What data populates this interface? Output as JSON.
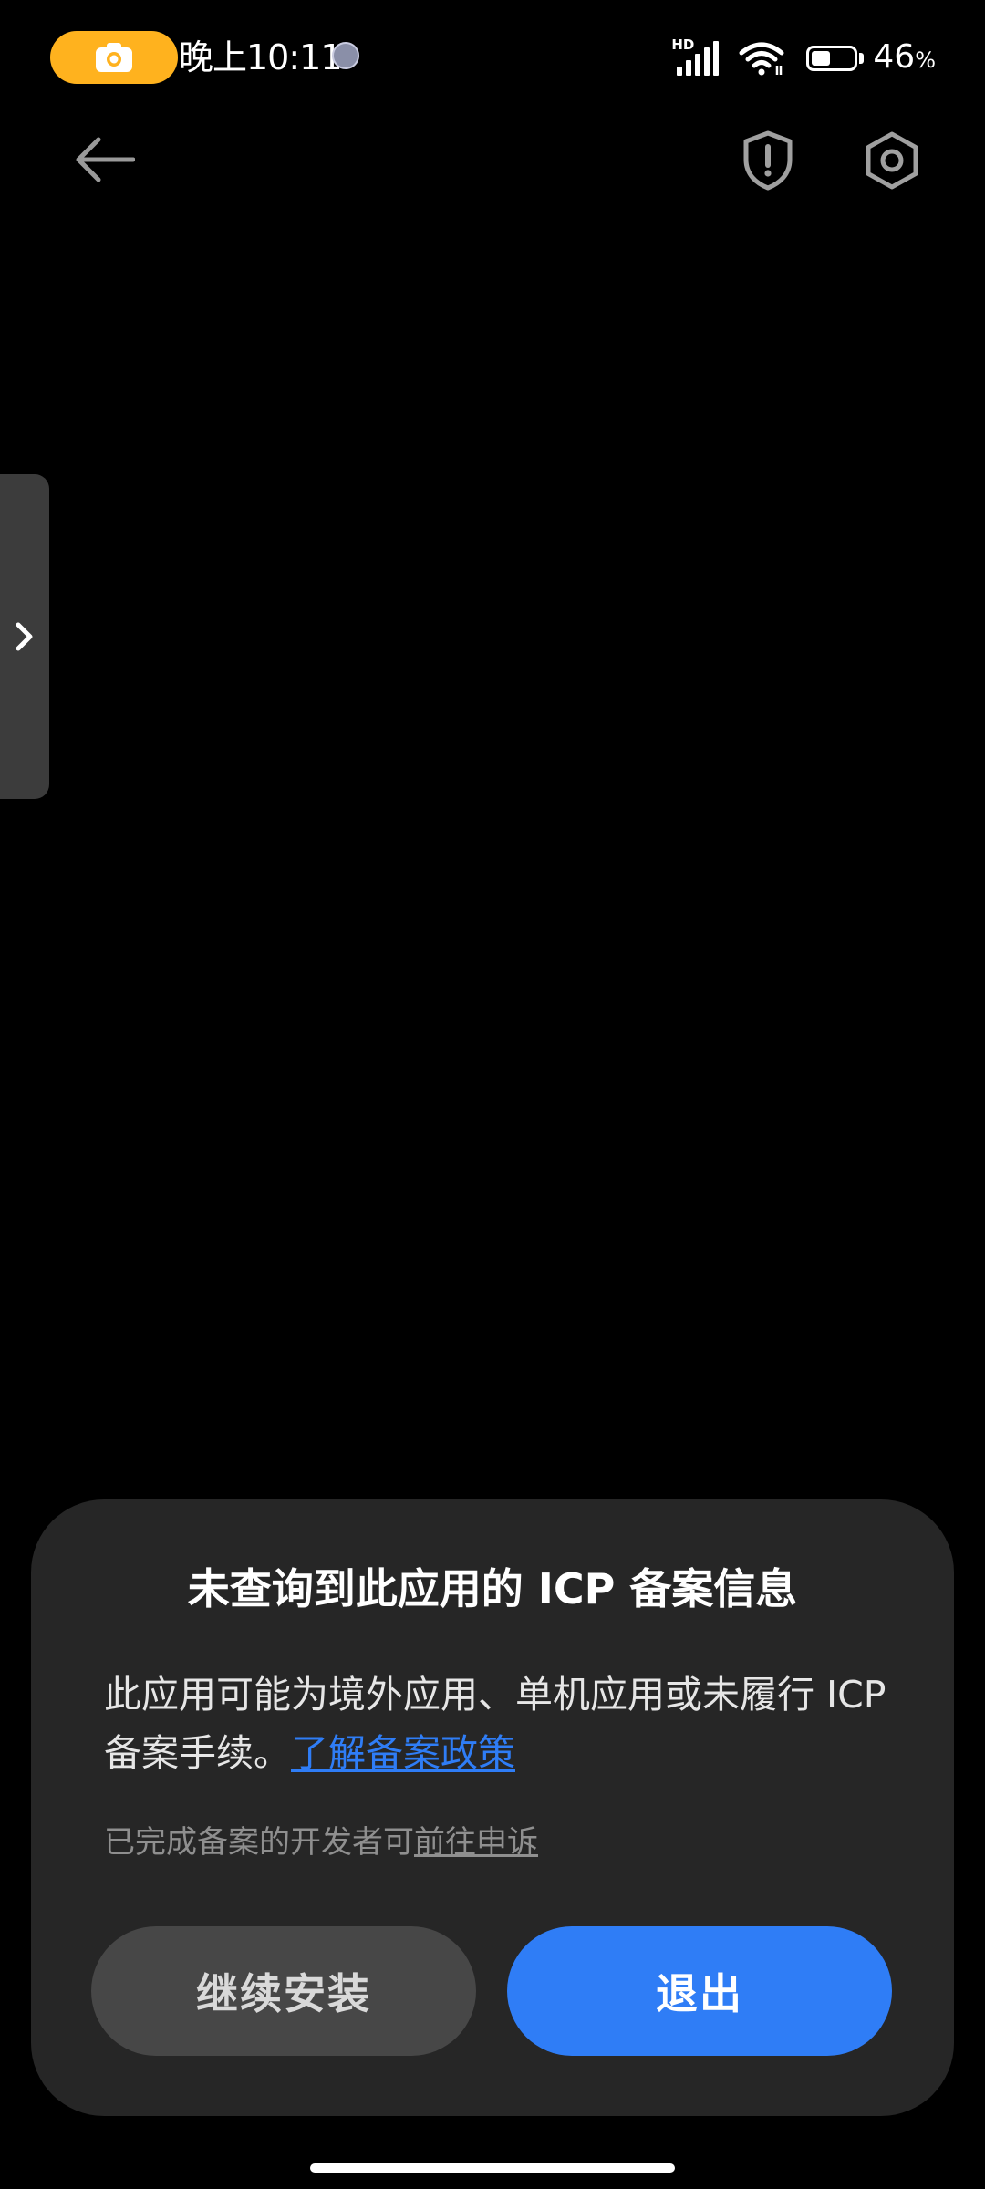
{
  "status_bar": {
    "time": "晚上10:11",
    "network_badge": "HD",
    "battery_level": 0.46,
    "battery_number": "46",
    "battery_unit": "%",
    "recording_pill_color": "#FFB21E"
  },
  "app_bar": {
    "back_icon": "arrow-left-icon",
    "shield_icon": "shield-alert-icon",
    "settings_icon": "gear-icon"
  },
  "side_panel": {
    "icon": "chevron-right-icon"
  },
  "dialog": {
    "title": "未查询到此应用的 ICP 备案信息",
    "message": "此应用可能为境外应用、单机应用或未履行 ICP 备案手续。",
    "policy_link": "了解备案政策",
    "hint": "已完成备案的开发者可",
    "appeal_link": "前往申诉",
    "continue_button": "继续安装",
    "exit_button": "退出"
  },
  "colors": {
    "accent": "#2f7df6",
    "dialog_background": "#262626",
    "secondary_button": "#474747"
  }
}
